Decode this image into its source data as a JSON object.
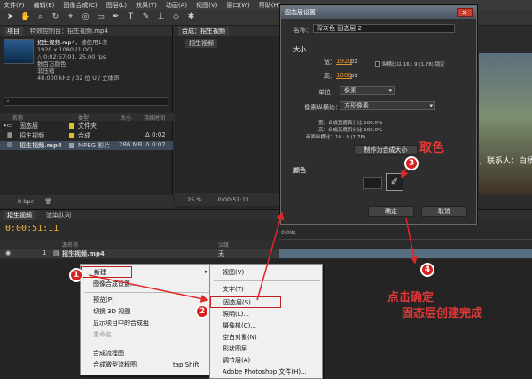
{
  "menubar": [
    "文件(F)",
    "编辑(E)",
    "图像合成(C)",
    "图层(L)",
    "效果(T)",
    "动画(A)",
    "视图(V)",
    "窗口(W)",
    "帮助(H)"
  ],
  "project": {
    "tab_project": "项目",
    "tab_effects": "特效控制台：招生视频.mp4",
    "item_name": "招生视频.mp4",
    "item_use": "，被使用1次",
    "info_lines": [
      "1920 x 1080 (1.00)",
      "△ 0:02:57:01, 25.00 fps",
      "数百万颜色",
      "非压缩",
      "48.000 kHz / 32 位 U / 立体声"
    ],
    "columns": {
      "name": "名称",
      "type": "类型",
      "size": "大小",
      "duration": "持续时间"
    },
    "rows": [
      {
        "name": "固态层",
        "type": "文件夹",
        "size": "",
        "duration": "",
        "color": "#d8c030"
      },
      {
        "name": "招生视频",
        "type": "合成",
        "size": "",
        "duration": "Δ 0:02",
        "color": "#d8c030"
      },
      {
        "name": "招生视频.mp4",
        "type": "MPEG 影片",
        "size": "286 MB",
        "duration": "Δ 0:02",
        "color": "#9aa0a8"
      }
    ],
    "bpc": "8 bpc"
  },
  "comp": {
    "tab": "合成：招生视频",
    "sub_tab": "招生视频",
    "zoom": "25 %",
    "time": "0:00:51:11"
  },
  "viewer_caption": "，联系人：白杨",
  "timeline": {
    "tab_comp": "招生视频",
    "tab_render": "渲染队列",
    "timecode": "0:00:51:11",
    "col_source": "源名称",
    "col_parent": "父级",
    "layer_index": "1",
    "layer_name": "招生视频.mp4",
    "layer_parent": "无",
    "ruler_start": "0:00s"
  },
  "dialog": {
    "title": "固态层设置",
    "name_label": "名称：",
    "name_value": "深灰色 固态层 2",
    "size_label": "大小",
    "width_label": "宽：",
    "width_value": "1920",
    "width_unit": "px",
    "height_label": "高：",
    "height_value": "1080",
    "height_unit": "px",
    "lock_label": "纵横比以 16 : 9 (1.78) 锁定",
    "units_label": "单位：",
    "units_value": "像素",
    "par_label": "像素纵横比：",
    "par_value": "方形像素",
    "pct_w": "宽：合成宽度百分比 100.0%",
    "pct_h": "高：合成高度百分比 100.0%",
    "frame_ar": "画面纵横比：16 : 9 (1.78)",
    "make_comp_btn": "制作为合成大小",
    "color_label": "颜色",
    "ok": "确定",
    "cancel": "取消"
  },
  "menu_main": {
    "items": [
      {
        "label": "新建",
        "arrow": "▸",
        "disabled": false
      },
      {
        "label": "图像合成设置...",
        "disabled": false
      },
      {
        "label": "预览(P)",
        "disabled": false
      },
      {
        "label": "切换 3D 视图",
        "disabled": false
      },
      {
        "label": "显示项目中的合成组",
        "disabled": false
      },
      {
        "label": "重命名",
        "disabled": true
      },
      {
        "label": "合成流程图",
        "disabled": false
      },
      {
        "label": "合成微型流程图",
        "shortcut": "tap Shift",
        "disabled": false
      }
    ]
  },
  "menu_new": {
    "items": [
      {
        "label": "视图(V)"
      },
      {
        "label": "文字(T)"
      },
      {
        "label": "固态层(S)..."
      },
      {
        "label": "照明(L)..."
      },
      {
        "label": "摄像机(C)..."
      },
      {
        "label": "空白对象(N)"
      },
      {
        "label": "形状图层"
      },
      {
        "label": "调节层(A)"
      },
      {
        "label": "Adobe Photoshop 文件(H)..."
      }
    ]
  },
  "annotations": {
    "badges": [
      "1",
      "2",
      "3",
      "4"
    ],
    "pick_color": "取色",
    "confirm_line1": "点击确定",
    "confirm_line2": "固态层创建完成",
    "color": "#e02828"
  }
}
